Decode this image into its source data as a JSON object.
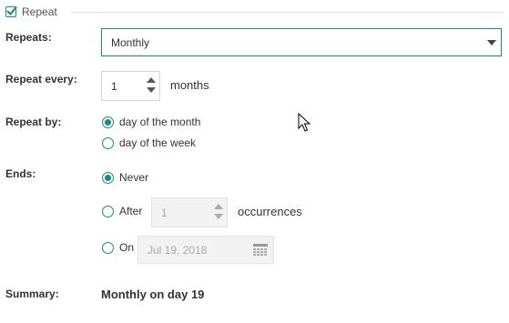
{
  "section": {
    "title": "Repeat",
    "checked": true
  },
  "repeats": {
    "label": "Repeats:",
    "selected": "Monthly"
  },
  "repeat_every": {
    "label": "Repeat every:",
    "value": "1",
    "unit": "months"
  },
  "repeat_by": {
    "label": "Repeat by:",
    "options": [
      {
        "label": "day of the month",
        "selected": true
      },
      {
        "label": "day of the week",
        "selected": false
      }
    ]
  },
  "ends": {
    "label": "Ends:",
    "never_label": "Never",
    "after_label": "After",
    "after_value": "1",
    "after_unit": "occurrences",
    "on_label": "On",
    "on_date": "Jul 19, 2018",
    "selected": "Never"
  },
  "summary": {
    "label": "Summary:",
    "value": "Monthly on day 19"
  },
  "colors": {
    "accent": "#1a8a79",
    "text": "#333333",
    "disabled_bg": "#f2f2f2"
  }
}
